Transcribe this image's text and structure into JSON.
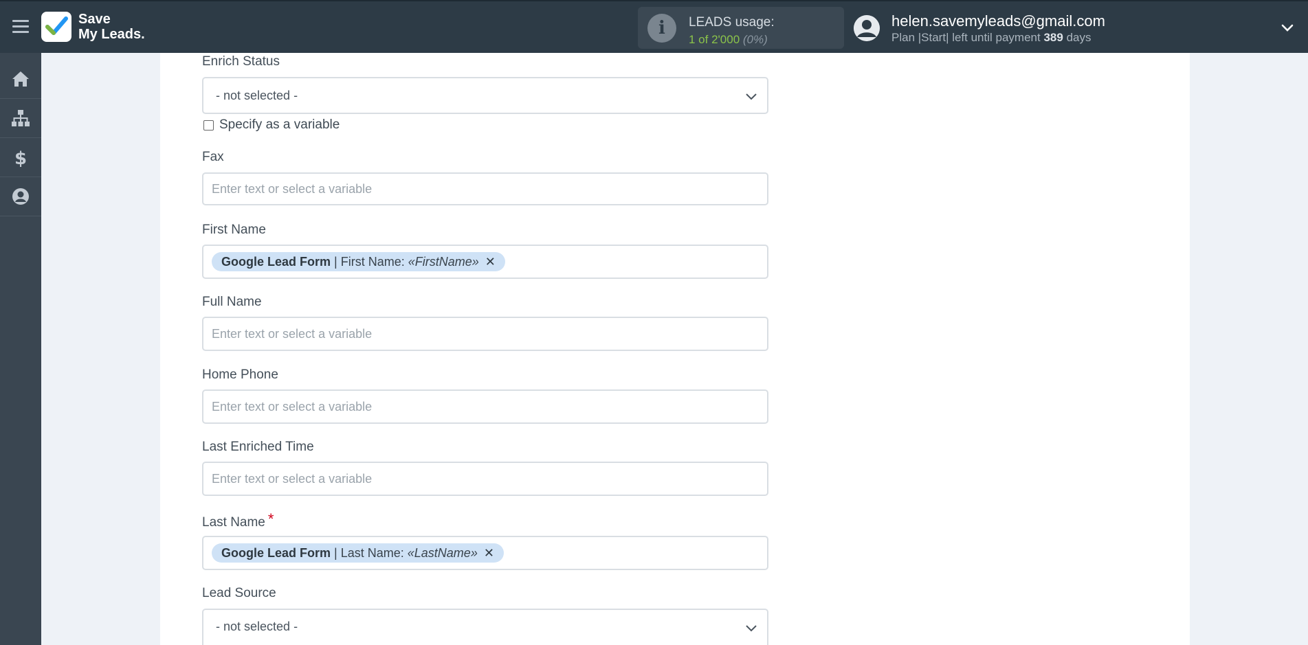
{
  "header": {
    "brand_line1": "Save",
    "brand_line2": "My Leads.",
    "usage_title": "LEADS usage:",
    "usage_count": "1 of 2'000",
    "usage_pct": "(0%)",
    "user_email": "helen.savemyleads@gmail.com",
    "plan_prefix": "Plan |Start| left until payment",
    "plan_days": "389",
    "plan_suffix": "days"
  },
  "sidebar": {
    "items": [
      {
        "icon": "home-icon"
      },
      {
        "icon": "sitemap-icon"
      },
      {
        "icon": "dollar-icon"
      },
      {
        "icon": "user-circle-icon"
      }
    ]
  },
  "form": {
    "enrich_status": {
      "label": "Enrich Status",
      "value": "- not selected -"
    },
    "specify_variable": "Specify as a variable",
    "fax": {
      "label": "Fax",
      "placeholder": "Enter text or select a variable"
    },
    "first_name": {
      "label": "First Name",
      "chip_source": "Google Lead Form",
      "chip_field": "| First Name:",
      "chip_var": "«FirstName»",
      "chip_remove": "✕"
    },
    "full_name": {
      "label": "Full Name",
      "placeholder": "Enter text or select a variable"
    },
    "home_phone": {
      "label": "Home Phone",
      "placeholder": "Enter text or select a variable"
    },
    "last_enriched_time": {
      "label": "Last Enriched Time",
      "placeholder": "Enter text or select a variable"
    },
    "last_name": {
      "label": "Last Name",
      "required_mark": "*",
      "chip_source": "Google Lead Form",
      "chip_field": "| Last Name:",
      "chip_var": "«LastName»",
      "chip_remove": "✕"
    },
    "lead_source": {
      "label": "Lead Source",
      "value": "- not selected -"
    }
  },
  "colors": {
    "topbar": "#2d3b46",
    "sidebar": "#3a4651",
    "chip": "#cfe2f6",
    "usage_green": "#8bc34a",
    "required": "#d0021b"
  }
}
